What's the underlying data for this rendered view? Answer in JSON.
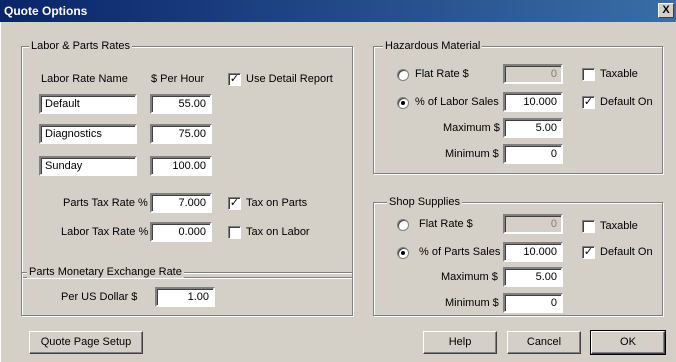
{
  "window": {
    "title": "Quote Options",
    "close_label": "X"
  },
  "labor": {
    "group_title": "Labor & Parts Rates",
    "col_name": "Labor Rate Name",
    "col_rate": "$ Per Hour",
    "use_detail_report": "Use Detail Report",
    "rows": [
      {
        "name": "Default",
        "rate": "55.00"
      },
      {
        "name": "Diagnostics",
        "rate": "75.00"
      },
      {
        "name": "Sunday",
        "rate": "100.00"
      }
    ],
    "parts_tax_label": "Parts Tax Rate %",
    "parts_tax_value": "7.000",
    "tax_on_parts": "Tax on Parts",
    "labor_tax_label": "Labor Tax Rate %",
    "labor_tax_value": "0.000",
    "tax_on_labor": "Tax on Labor"
  },
  "exchange": {
    "group_title": "Parts Monetary Exchange Rate",
    "per_us_dollar_label": "Per US Dollar $",
    "per_us_dollar_value": "1.00"
  },
  "hazardous": {
    "group_title": "Hazardous Material",
    "flat_rate_label": "Flat Rate $",
    "flat_rate_value": "0",
    "taxable": "Taxable",
    "percent_label": "% of Labor Sales",
    "percent_value": "10.000",
    "default_on": "Default On",
    "maximum_label": "Maximum $",
    "maximum_value": "5.00",
    "minimum_label": "Minimum $",
    "minimum_value": "0"
  },
  "shop_supplies": {
    "group_title": "Shop Supplies",
    "flat_rate_label": "Flat Rate $",
    "flat_rate_value": "0",
    "taxable": "Taxable",
    "percent_label": "% of Parts Sales",
    "percent_value": "10.000",
    "default_on": "Default On",
    "maximum_label": "Maximum $",
    "maximum_value": "5.00",
    "minimum_label": "Minimum $",
    "minimum_value": "0"
  },
  "buttons": {
    "quote_page_setup": "Quote Page Setup",
    "help": "Help",
    "cancel": "Cancel",
    "ok": "OK"
  },
  "check_mark": "✓"
}
